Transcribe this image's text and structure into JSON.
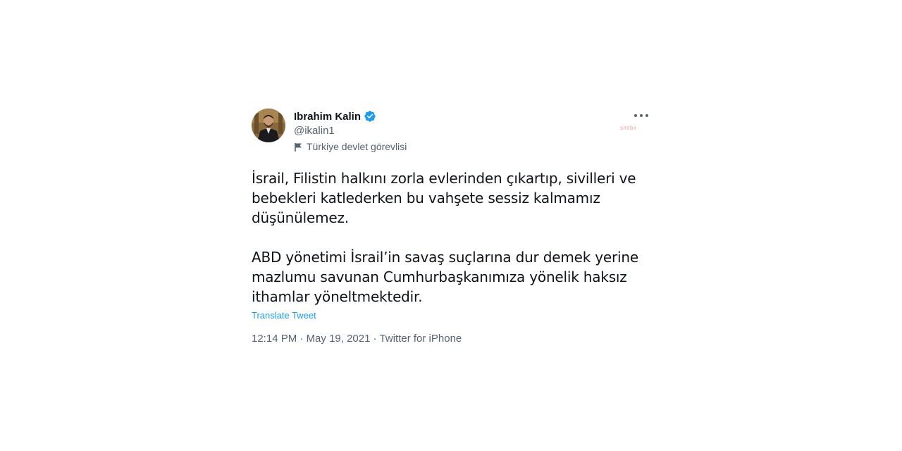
{
  "author": {
    "display_name": "Ibrahim Kalin",
    "handle": "@ikalin1",
    "verified": true,
    "avatar_icon": "profile-photo",
    "account_label": "Türkiye devlet görevlisi",
    "account_label_icon": "flag-icon"
  },
  "tweet": {
    "paragraph1": [
      "İsrail, Filistin halkını zorla evlerinden çıkartıp, sivilleri ve",
      "bebekleri katlederken bu vahşete sessiz kalmamız",
      "düşünülemez."
    ],
    "paragraph2": [
      "ABD yönetimi İsrail’in savaş suçlarına dur demek yerine",
      "mazlumu savunan Cumhurbaşkanımıza yönelik haksız",
      "ithamlar yöneltmektedir."
    ],
    "translate_label": "Translate Tweet",
    "time": "12:14 PM",
    "separator": " · ",
    "date": "May 19, 2021",
    "source": "Twitter for iPhone"
  },
  "watermark": "smlbx",
  "colors": {
    "text_primary": "#0f1419",
    "text_secondary": "#536471",
    "link": "#1d9bf0",
    "verified": "#1d9bf0"
  }
}
